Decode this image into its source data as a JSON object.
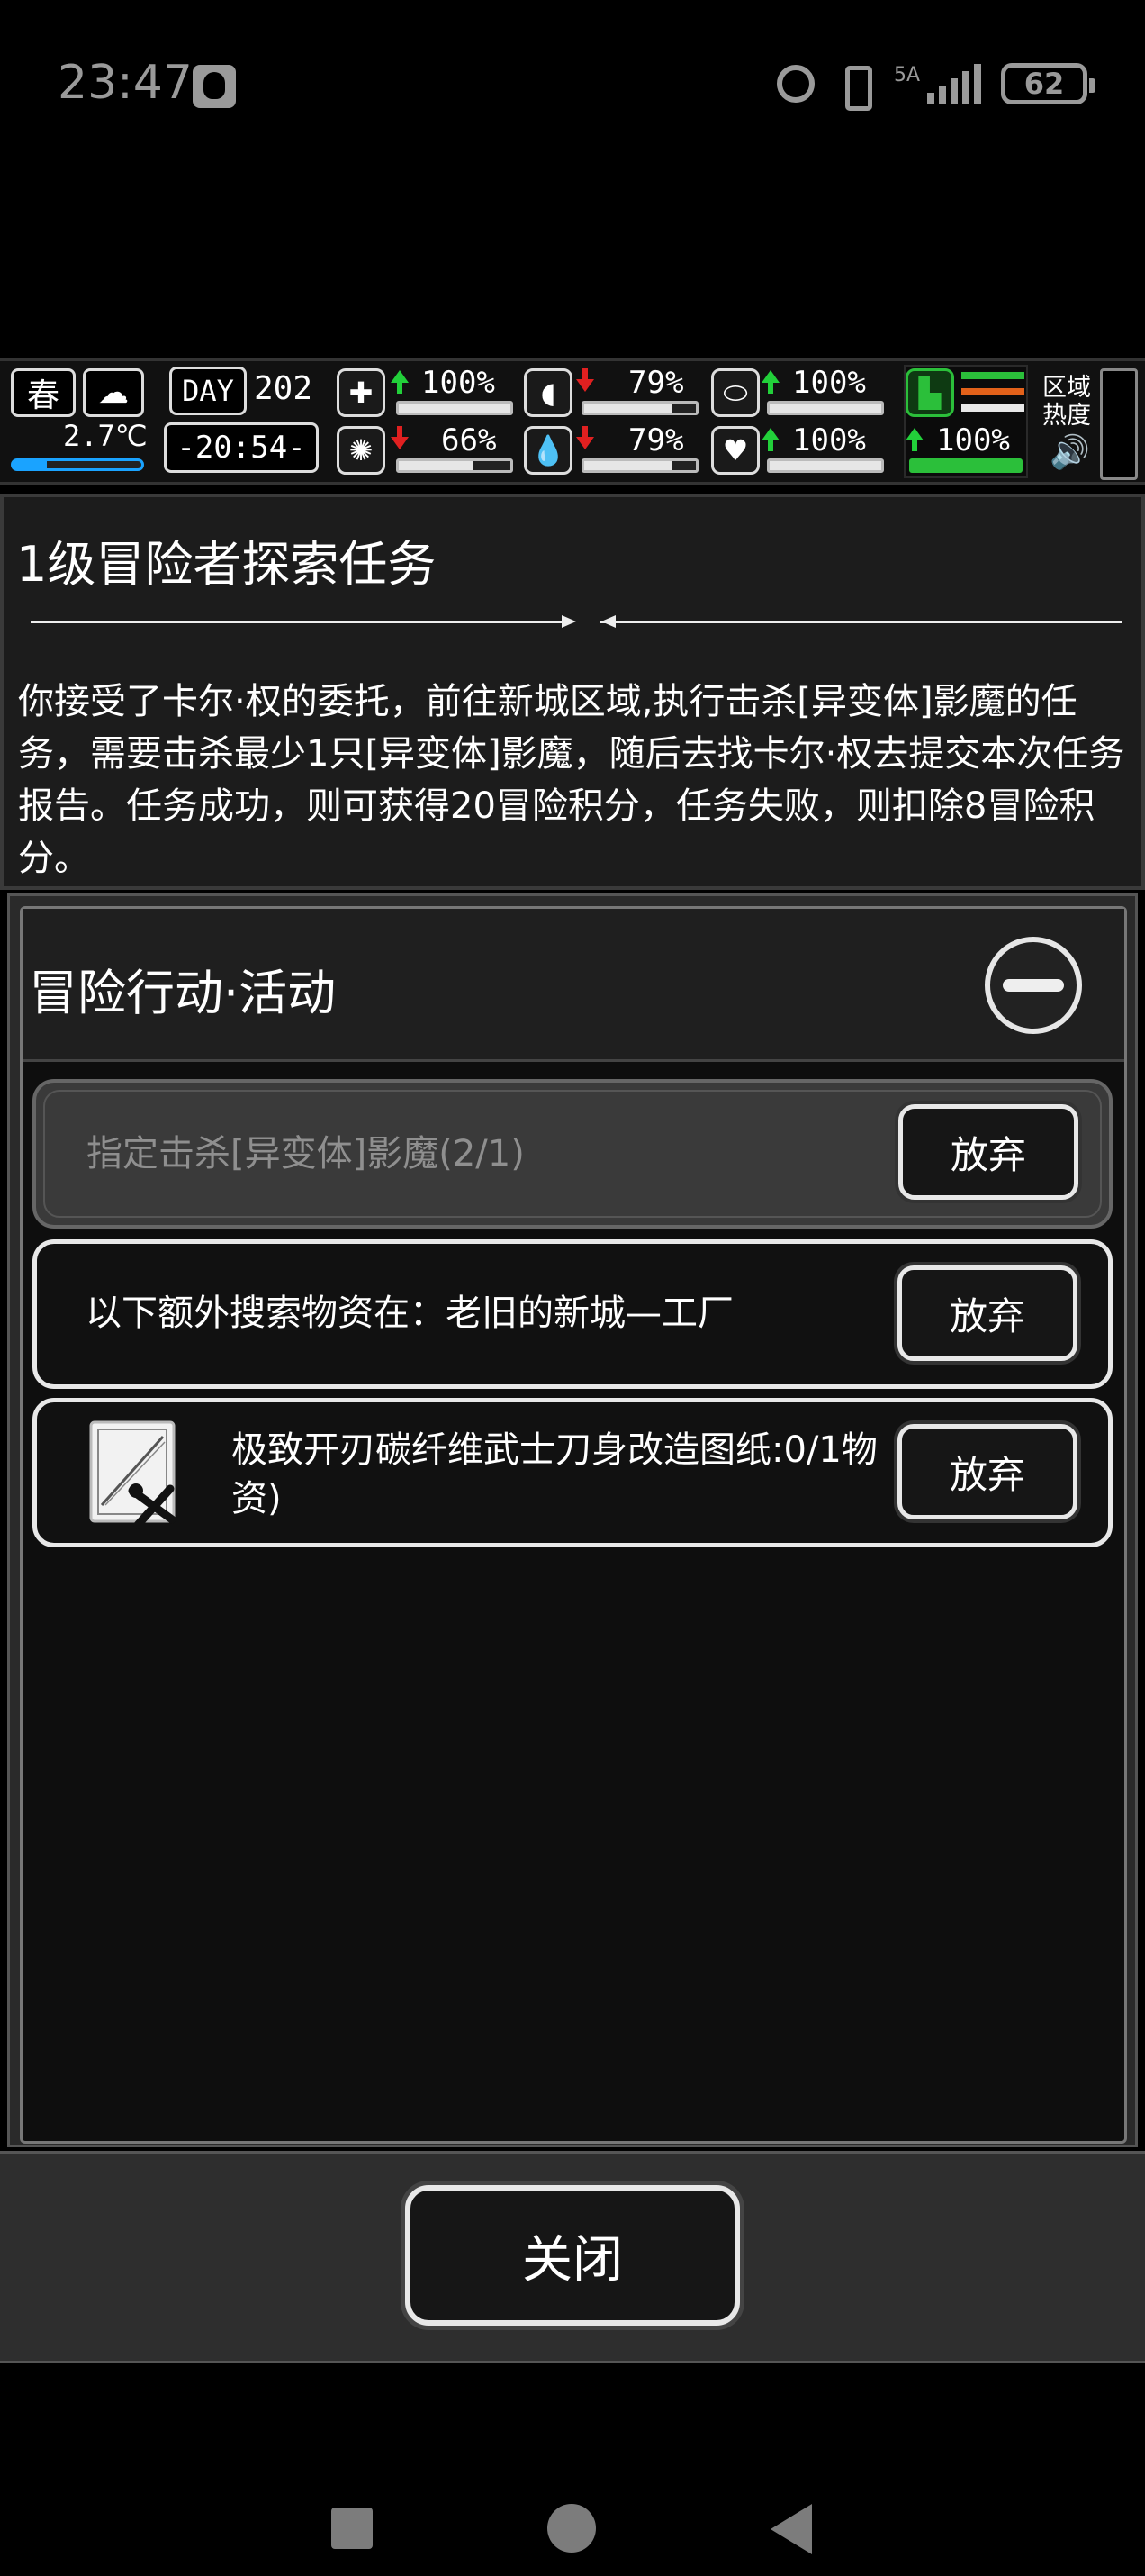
{
  "status_bar": {
    "time": "23:47",
    "network": "5A",
    "battery": "62"
  },
  "hud": {
    "season": "春",
    "temperature": "2.7℃",
    "day_label": "DAY",
    "day_number": "202",
    "clock": "-20:54-",
    "stats": [
      {
        "name": "health",
        "icon": "first-aid-icon",
        "trend": "up",
        "value": "100%",
        "level": 1.0
      },
      {
        "name": "hunger",
        "icon": "stomach-icon",
        "trend": "down",
        "value": "79%",
        "level": 0.79
      },
      {
        "name": "stamina",
        "icon": "pill-icon",
        "trend": "up",
        "value": "100%",
        "level": 1.0
      },
      {
        "name": "sanity",
        "icon": "brain-icon",
        "trend": "down",
        "value": "66%",
        "level": 0.66
      },
      {
        "name": "thirst",
        "icon": "water-drop-icon",
        "trend": "down",
        "value": "79%",
        "level": 0.79
      },
      {
        "name": "mood",
        "icon": "heart-icon",
        "trend": "up",
        "value": "100%",
        "level": 1.0
      }
    ],
    "boot_stat": {
      "icon": "boot-icon",
      "trend": "up",
      "value": "100%",
      "level": 1.0
    },
    "zone_heat_label": "区域热度",
    "colors": {
      "up": "#22d03a",
      "down": "#e02020",
      "green": "#2bbf3a",
      "orange": "#e2611a"
    }
  },
  "quest": {
    "title": "1级冒险者探索任务",
    "description": "你接受了卡尔·权的委托，前往新城区域,执行击杀[异变体]影魔的任务，需要击杀最少1只[异变体]影魔，随后去找卡尔·权去提交本次任务报告。任务成功，则可获得20冒险积分，任务失败，则扣除8冒险积分。"
  },
  "actions": {
    "title": "冒险行动·活动",
    "tasks": [
      {
        "text": "指定击杀[异变体]影魔(2/1)",
        "button": "放弃",
        "state": "disabled"
      },
      {
        "text": "以下额外搜索物资在：老旧的新城—工厂",
        "button": "放弃",
        "state": "active"
      },
      {
        "text": "极致开刃碳纤维武士刀身改造图纸:0/1物资)",
        "button": "放弃",
        "state": "active",
        "icon": "blueprint-icon"
      }
    ]
  },
  "close_button": "关闭"
}
